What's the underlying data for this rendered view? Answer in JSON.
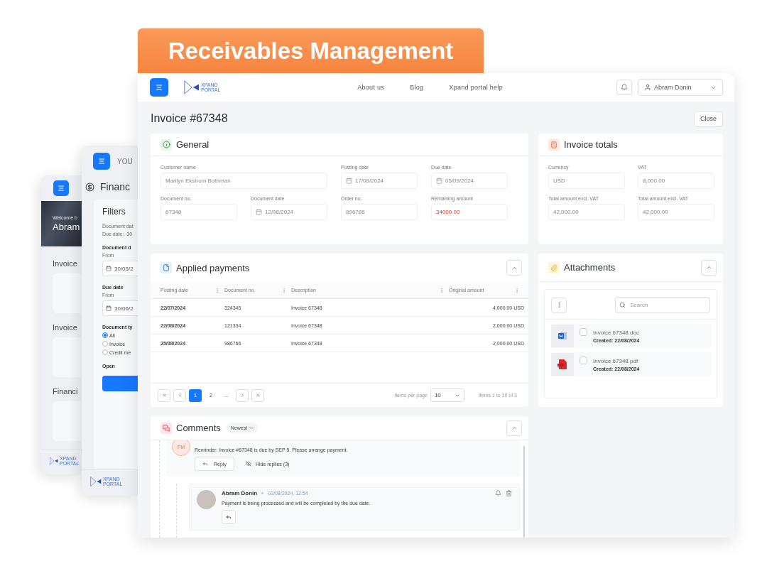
{
  "banner": {
    "title": "Receivables Management"
  },
  "dashboard_window": {
    "welcome": "Welcome b",
    "name": "Abram",
    "sections": [
      "Invoice",
      "Invoice",
      "Financi"
    ],
    "logo": "XPAND PORTAL"
  },
  "finance_window": {
    "header": "YOU",
    "title": "Financ",
    "filters_title": "Filters",
    "summary": [
      {
        "label": "Document dat"
      },
      {
        "label": "Due date:",
        "value": "30"
      }
    ],
    "groups": [
      {
        "title": "Document d",
        "from": "From",
        "date": "30/05/2"
      },
      {
        "title": "Due date",
        "from": "From",
        "date": "30/06/2"
      }
    ],
    "type_title": "Document ty",
    "types": [
      {
        "label": "All",
        "selected": true
      },
      {
        "label": "Invoice",
        "selected": false
      },
      {
        "label": "Credit me",
        "selected": false
      }
    ],
    "open": "Open",
    "logo": "XPAND PORTAL"
  },
  "window": {
    "logo": "XPAND PORTAL",
    "nav": [
      "About us",
      "Blog",
      "Xpand portal help"
    ],
    "user": "Abram Donin",
    "title": "Invoice #67348",
    "close": "Close"
  },
  "general": {
    "title": "General",
    "fields": [
      {
        "label": "Customer name",
        "value": "Marilyn Ekstrom Bothman",
        "kind": "text"
      },
      {
        "label": "Posting date",
        "value": "17/08/2024",
        "kind": "date"
      },
      {
        "label": "Due date",
        "value": "05/09/2024",
        "kind": "date"
      },
      {
        "label": "Document no.",
        "value": "67348",
        "kind": "text"
      },
      {
        "label": "Document date",
        "value": "12/08/2024",
        "kind": "date"
      },
      {
        "label": "Order no.",
        "value": "896786",
        "kind": "text"
      },
      {
        "label": "Remaining amount",
        "value": "34000.00",
        "kind": "amount"
      }
    ]
  },
  "totals": {
    "title": "Invoice totals",
    "fields": [
      {
        "label": "Currency",
        "value": "USD"
      },
      {
        "label": "VAT",
        "value": "8,000.00"
      },
      {
        "label": "Total amount excl. VAT",
        "value": "42,000.00"
      },
      {
        "label": "Total amount excl. VAT",
        "value": "42,000.00"
      }
    ]
  },
  "payments": {
    "title": "Applied payments",
    "columns": [
      "Posting date",
      "Document no.",
      "Description",
      "Original amount"
    ],
    "rows": [
      [
        "22/07/2024",
        "324345",
        "Invoice 67348",
        "4,000.00 USD"
      ],
      [
        "22/08/2024",
        "121334",
        "Invoice 67348",
        "2,000.00 USD"
      ],
      [
        "25/08/2024",
        "986766",
        "Invoice 67348",
        "2,000.00 USD"
      ]
    ],
    "pages": [
      {
        "label": "1",
        "selected": true
      },
      {
        "label": "2",
        "selected": false
      },
      {
        "label": "...",
        "selected": false
      }
    ],
    "per_page_label": "Items per page",
    "per_page": "10",
    "summary": "Items 1 to 10 of 3"
  },
  "attachments": {
    "title": "Attachments",
    "search_placeholder": "Search",
    "files": [
      {
        "name": "Invoice 67348.doc",
        "created": "Created: 22/08/2024",
        "kind": "doc",
        "checked": false
      },
      {
        "name": "Invoice 67348.pdf",
        "created": "Created: 22/08/2024",
        "kind": "pdf",
        "checked": false
      }
    ]
  },
  "comments": {
    "title": "Comments",
    "sort": "Newest",
    "comment": {
      "initials": "FM",
      "text": "Reminder: Invoice #67348 is due by SEP 5. Please arrange payment.",
      "reply": "Reply",
      "hide": "Hide replies (3)"
    },
    "reply": {
      "author": "Abram Donin",
      "time": "02/08/2024, 12:54",
      "text": "Payment is being processed and will be completed by the due date."
    }
  }
}
